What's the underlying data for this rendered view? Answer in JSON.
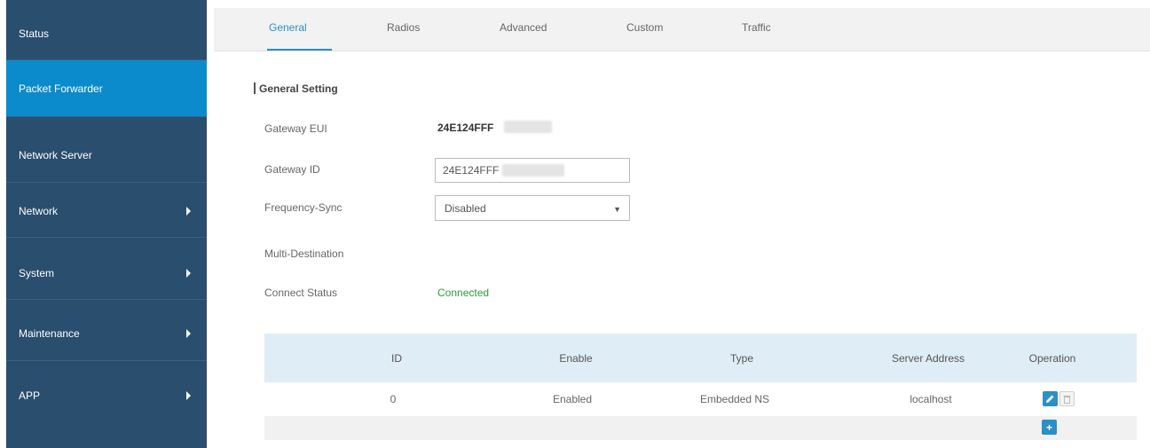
{
  "sidebar": {
    "items": [
      {
        "label": "Status",
        "has_submenu": false,
        "active": false
      },
      {
        "label": "Packet Forwarder",
        "has_submenu": false,
        "active": true
      },
      {
        "label": "Network Server",
        "has_submenu": false,
        "active": false
      },
      {
        "label": "Network",
        "has_submenu": true,
        "active": false
      },
      {
        "label": "System",
        "has_submenu": true,
        "active": false
      },
      {
        "label": "Maintenance",
        "has_submenu": true,
        "active": false
      },
      {
        "label": "APP",
        "has_submenu": true,
        "active": false
      }
    ]
  },
  "tabs": [
    {
      "label": "General",
      "active": true
    },
    {
      "label": "Radios",
      "active": false
    },
    {
      "label": "Advanced",
      "active": false
    },
    {
      "label": "Custom",
      "active": false
    },
    {
      "label": "Traffic",
      "active": false
    }
  ],
  "general": {
    "section_title": "General Setting",
    "gateway_eui_label": "Gateway EUI",
    "gateway_eui_value": "24E124FFF",
    "gateway_id_label": "Gateway ID",
    "gateway_id_value": "24E124FFF",
    "frequency_sync_label": "Frequency-Sync",
    "frequency_sync_value": "Disabled",
    "multi_destination_label": "Multi-Destination",
    "connect_status_label": "Connect Status",
    "connect_status_value": "Connected"
  },
  "table": {
    "headers": {
      "id": "ID",
      "enable": "Enable",
      "type": "Type",
      "server_address": "Server Address",
      "operation": "Operation"
    },
    "rows": [
      {
        "id": "0",
        "enable": "Enabled",
        "type": "Embedded NS",
        "server_address": "localhost"
      }
    ]
  },
  "icons": {
    "edit": "edit-icon",
    "delete": "delete-icon",
    "add": "add-icon"
  },
  "colors": {
    "sidebar_bg": "#2a4e6d",
    "sidebar_active": "#0b8bcb",
    "accent": "#2b8fc8",
    "connected": "#2e9a3c",
    "table_header_bg": "#dfedf7"
  }
}
